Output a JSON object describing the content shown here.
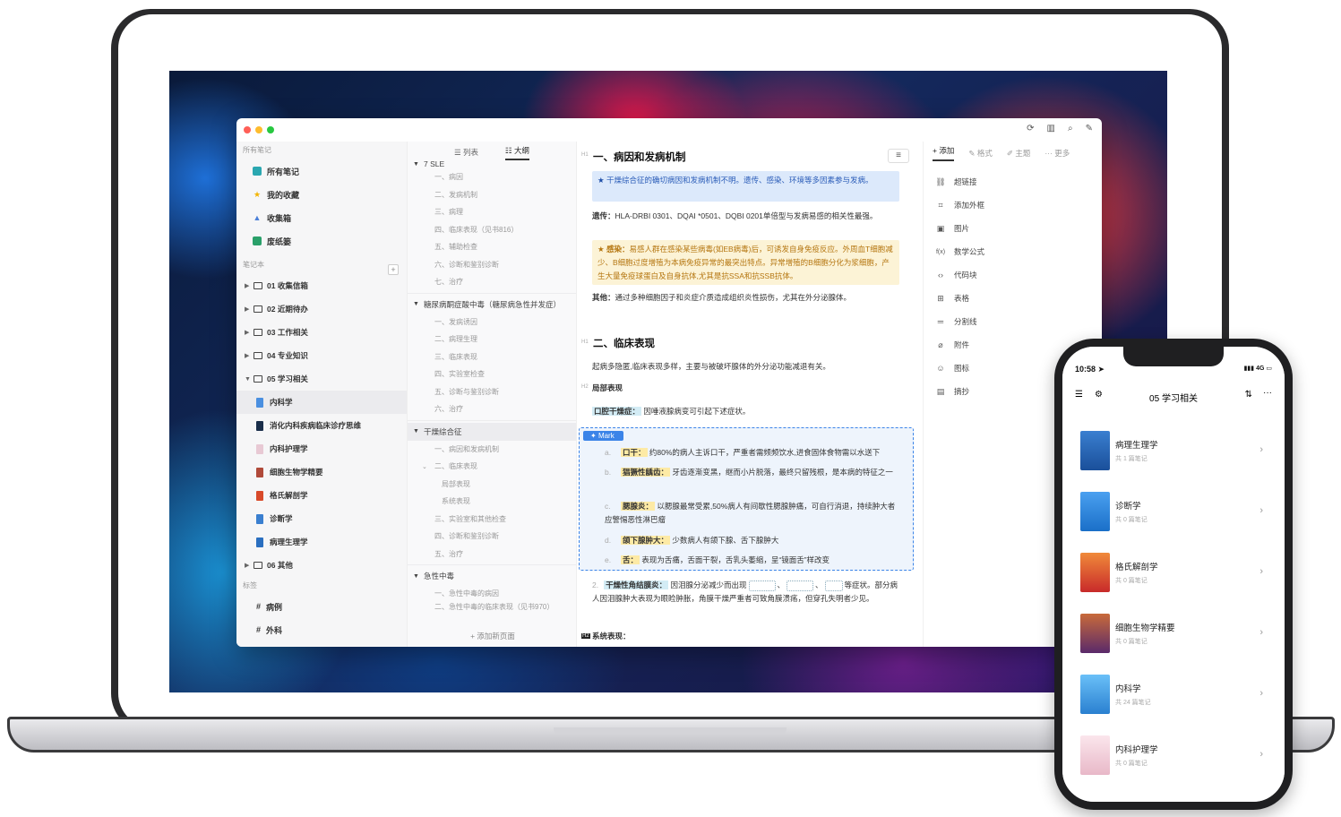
{
  "window": {
    "traffic": [
      "#ff5f57",
      "#febc2e",
      "#28c840"
    ]
  },
  "sidebar": {
    "section_all": "所有笔记",
    "fixed": [
      {
        "label": "所有笔记",
        "icon": "notes-icon",
        "color": "#2aa7b0"
      },
      {
        "label": "我的收藏",
        "icon": "star-icon",
        "color": "#f3b400"
      },
      {
        "label": "收集箱",
        "icon": "inbox-icon",
        "color": "#4a7fd8"
      },
      {
        "label": "废纸篓",
        "icon": "trash-icon",
        "color": "#2aa06a"
      }
    ],
    "section_notebooks": "笔记本",
    "folders": [
      {
        "label": "01 收集信箱"
      },
      {
        "label": "02 近期待办"
      },
      {
        "label": "03 工作相关"
      },
      {
        "label": "04 专业知识"
      },
      {
        "label": "05 学习相关"
      }
    ],
    "sub_books": [
      {
        "label": "内科学",
        "color": "#4a8fe0"
      },
      {
        "label": "消化内科疾病临床诊疗思维",
        "color": "#1a2e4a"
      },
      {
        "label": "内科护理学",
        "color": "#e8c9d4"
      },
      {
        "label": "细胞生物学精要",
        "color": "#b04a3a"
      },
      {
        "label": "格氏解剖学",
        "color": "#d84a2a"
      },
      {
        "label": "诊断学",
        "color": "#3a7fd0"
      },
      {
        "label": "病理生理学",
        "color": "#2a6fc0"
      }
    ],
    "folder_other": "06 其他",
    "section_tags": "标签",
    "tags": [
      {
        "label": "病例"
      },
      {
        "label": "外科"
      }
    ]
  },
  "outline": {
    "tabs": [
      "列表",
      "大纲"
    ],
    "active_tab": "大纲",
    "top_group": "7 SLE",
    "g1_items": [
      "一、病因",
      "二、发病机制",
      "三、病理",
      "四、临床表现（见书816）",
      "五、辅助检查",
      "六、诊断和鉴别诊断",
      "七、治疗"
    ],
    "g2_title": "糖尿病酮症酸中毒（糖尿病急性并发症）",
    "g2_items": [
      "一、发病诱因",
      "二、病理生理",
      "三、临床表现",
      "四、实验室检查",
      "五、诊断与鉴别诊断",
      "六、治疗"
    ],
    "g3_title": "干燥综合征",
    "g3_items": [
      "一、病因和发病机制",
      "二、临床表现"
    ],
    "g3_sub": [
      "局部表现",
      "系统表现"
    ],
    "g3_items2": [
      "三、实验室和其他检查",
      "四、诊断和鉴别诊断",
      "五、治疗"
    ],
    "g4_title": "急性中毒",
    "g4_items": [
      "一、急性中毒的病因",
      "二、急性中毒的临床表现（见书970）"
    ],
    "add_page": "添加新页面"
  },
  "editor": {
    "h1_tag": "H1",
    "h1_a": "一、病因和发病机制",
    "callout_blue": "干燥综合征的确切病因和发病机制不明。遗传、感染、环境等多因素参与发病。",
    "genetics_label": "遗传：",
    "genetics_text": "HLA-DRBI 0301、DQAI *0501、DQBI 0201单倍型与发病易感的相关性最强。",
    "callout_yellow_label": "感染：",
    "callout_yellow": "易感人群在感染某些病毒(如EB病毒)后，可诱发自身免疫反应。外周血T细胞减少、B细胞过度增殖为本病免疫异常的最突出特点。异常增殖的B细胞分化为浆细胞，产生大量免疫球蛋白及自身抗体,尤其是抗SSA和抗SSB抗体。",
    "other_label": "其他：",
    "other_text": "通过多种细胞因子和炎症介质造成组织炎性损伤，尤其在外分泌腺体。",
    "h1_b": "二、临床表现",
    "intro": "起病多隐匿,临床表现多样，主要与被破坏腺体的外分泌功能减退有关。",
    "h2_tag": "H2",
    "local_title": "局部表现",
    "item1_label": "口腔干燥症：",
    "item1_text": "因唾液腺病变可引起下述症状。",
    "mark_label": "Mark",
    "mark_rows": [
      {
        "idx": "a.",
        "label": "口干：",
        "text": "约80%的病人主诉口干，严重者需频频饮水,进食固体食物需以水送下"
      },
      {
        "idx": "b.",
        "label": "猖獗性龋齿：",
        "text": "牙齿逐渐变黑，继而小片脱落，最终只留残根，是本病的特征之一"
      },
      {
        "idx": "c.",
        "label": "腮腺炎：",
        "text": "以腮腺最常受累,50%病人有间歇性腮腺肿痛，可自行消退，持续肿大者应警惕恶性淋巴瘤"
      },
      {
        "idx": "d.",
        "label": "颌下腺肿大：",
        "text": "少数病人有颌下腺、舌下腺肿大"
      },
      {
        "idx": "e.",
        "label": "舌：",
        "text": "表现为舌痛，舌面干裂，舌乳头萎缩，呈“镜面舌”样改变"
      }
    ],
    "item2_idx": "2.",
    "item2_label": "干燥性角结膜炎：",
    "item2_text_a": "因泪腺分泌减少而出现",
    "item2_text_b": "等症状。部分病人因泪腺肿大表现为眼睑肿胀，角膜干燥严重者可致角膜溃疡，但穿孔失明者少见。",
    "sep": "、",
    "system_title": "系统表现："
  },
  "tools": {
    "tabs": [
      "添加",
      "格式",
      "主题",
      "更多"
    ],
    "items": [
      {
        "label": "超链接",
        "icon": "link-icon"
      },
      {
        "label": "添加外框",
        "icon": "frame-icon"
      },
      {
        "label": "图片",
        "icon": "image-icon"
      },
      {
        "label": "数学公式",
        "icon": "formula-icon"
      },
      {
        "label": "代码块",
        "icon": "code-icon"
      },
      {
        "label": "表格",
        "icon": "table-icon"
      },
      {
        "label": "分割线",
        "icon": "divider-icon"
      },
      {
        "label": "附件",
        "icon": "attachment-icon"
      },
      {
        "label": "图标",
        "icon": "emoji-icon"
      },
      {
        "label": "摘抄",
        "icon": "excerpt-icon"
      }
    ]
  },
  "phone": {
    "time": "10:58",
    "signal": "4G",
    "title": "05 学习相关",
    "books": [
      {
        "title": "病理生理学",
        "count": "共 1 篇笔记",
        "color": "#2a6fc0"
      },
      {
        "title": "诊断学",
        "count": "共 0 篇笔记",
        "color": "#3a8fe0"
      },
      {
        "title": "格氏解剖学",
        "count": "共 0 篇笔记",
        "color": "#d84a2a"
      },
      {
        "title": "细胞生物学精要",
        "count": "共 0 篇笔记",
        "color": "#8a3a5a"
      },
      {
        "title": "内科学",
        "count": "共 24 篇笔记",
        "color": "#4a9fe8"
      },
      {
        "title": "内科护理学",
        "count": "共 0 篇笔记",
        "color": "#f0d6de"
      }
    ]
  }
}
